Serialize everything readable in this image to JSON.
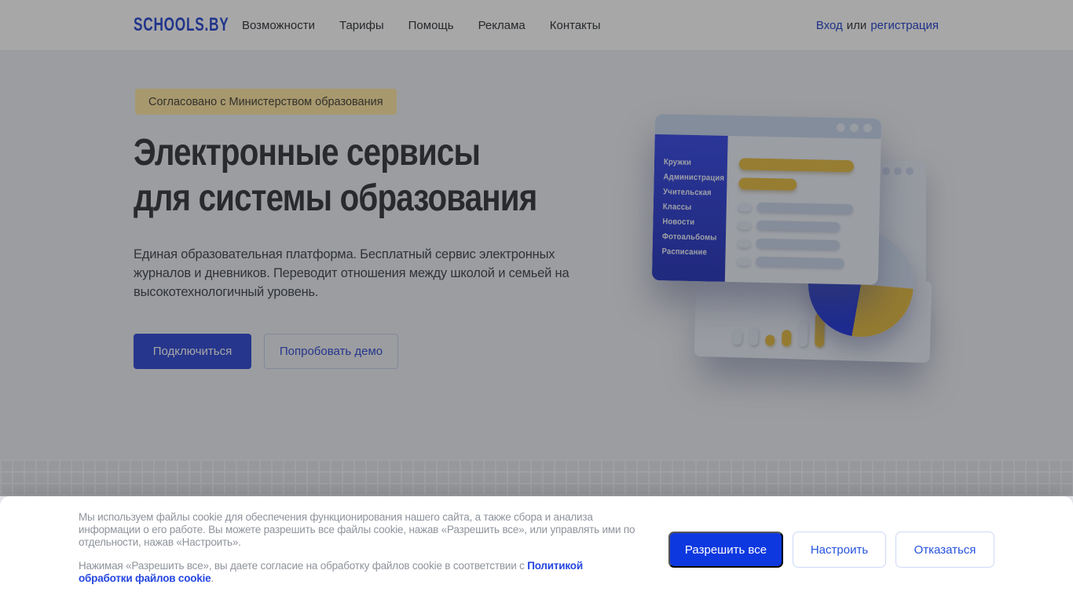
{
  "brand": {
    "logo": "SCHOOLS.BY"
  },
  "nav": {
    "items": [
      "Возможности",
      "Тарифы",
      "Помощь",
      "Реклама",
      "Контакты"
    ],
    "auth": {
      "login": "Вход",
      "separator": "или",
      "register": "регистрация"
    }
  },
  "hero": {
    "badge": "Согласовано с Министерством образования",
    "title_line1": "Электронные сервисы",
    "title_line2": "для системы образования",
    "description": "Единая образовательная платформа. Бесплатный сервис электронных журналов и дневников. Переводит отношения между школой и семьей на высокотехнологичный уровень.",
    "primary_button": "Подключиться",
    "secondary_button": "Попробовать демо"
  },
  "illustration": {
    "sidebar_items": [
      "Кружки",
      "Администрация",
      "Учительская",
      "Классы",
      "Новости",
      "Фотоальбомы",
      "Расписание"
    ]
  },
  "cookie_banner": {
    "paragraph1": "Мы используем файлы cookie для обеспечения функционирования нашего сайта, а также сбора и анализа информации о его работе. Вы можете разрешить все файлы cookie, нажав «Разрешить все», или управлять ими по отдельности, нажав «Настроить».",
    "paragraph2_prefix": "Нажимая «Разрешить все», вы даете согласие на обработку файлов cookie в соответствии с ",
    "paragraph2_link": "Политикой обработки файлов cookie",
    "paragraph2_suffix": ".",
    "buttons": {
      "allow": "Разрешить все",
      "configure": "Настроить",
      "decline": "Отказаться"
    }
  },
  "colors": {
    "accent_blue": "#3a53d6",
    "cookie_button_blue": "#0d38e0",
    "badge_yellow": "#ffe9a8",
    "illustration_sidebar_blue": "#4153e8",
    "illustration_yellow": "#e4bd4b",
    "overlay": "rgba(0,0,0,0.345)"
  }
}
